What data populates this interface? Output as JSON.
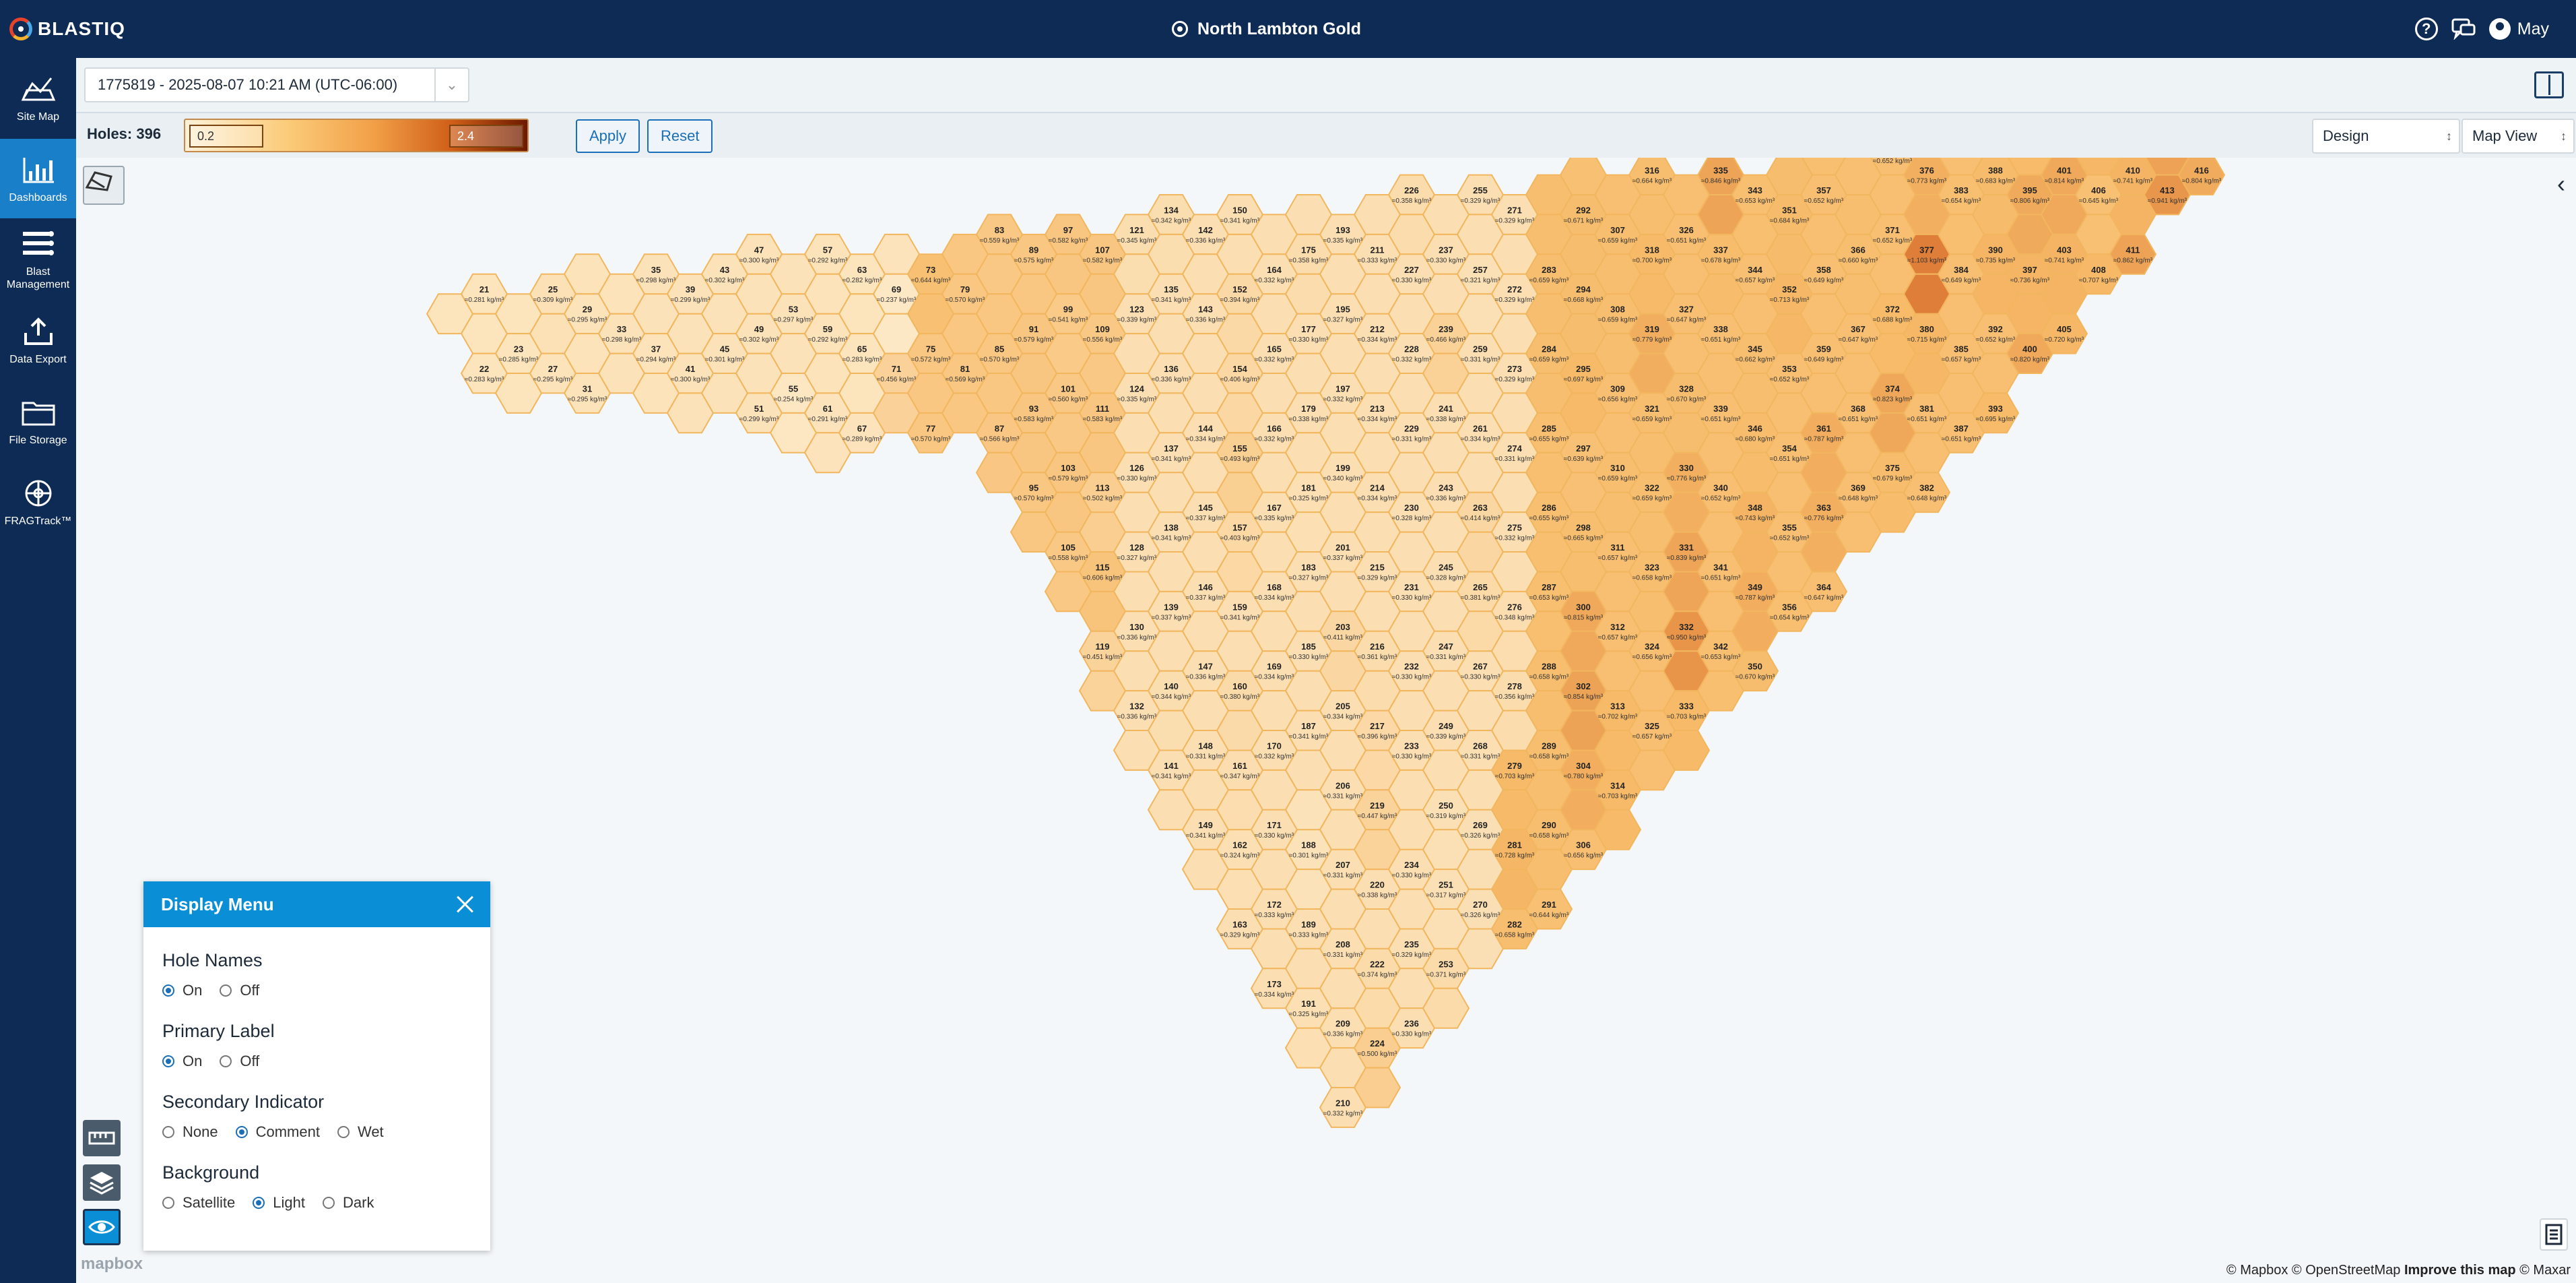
{
  "app": {
    "name": "BLASTIQ",
    "site": "North Lambton Gold",
    "user": "May"
  },
  "icons": {
    "help": "help-icon",
    "chat": "chat-icon",
    "user": "user-icon",
    "site": "location-target-icon"
  },
  "nav": [
    {
      "id": "site-map",
      "label": "Site Map",
      "icon": "site-map-icon",
      "active": false
    },
    {
      "id": "dashboards",
      "label": "Dashboards",
      "icon": "dashboards-icon",
      "active": true
    },
    {
      "id": "blast-management",
      "label": "Blast Management",
      "icon": "blast-management-icon",
      "active": false
    },
    {
      "id": "data-export",
      "label": "Data Export",
      "icon": "data-export-icon",
      "active": false
    },
    {
      "id": "file-storage",
      "label": "File Storage",
      "icon": "file-storage-icon",
      "active": false
    },
    {
      "id": "fragtrack",
      "label": "FRAGTrack™",
      "icon": "fragtrack-icon",
      "active": false
    }
  ],
  "toolbar": {
    "blast_selection": "1775819 - 2025-08-07 10:21 AM (UTC-06:00)",
    "holes_label": "Holes: 396",
    "scale_min": "0.2",
    "scale_max": "2.4",
    "apply_label": "Apply",
    "reset_label": "Reset",
    "design_value": "Design",
    "view_value": "Map View"
  },
  "colors": {
    "nav_bg": "#0d2b55",
    "accent": "#0a8fd6",
    "low": "#fde9c6",
    "mid": "#f6b866",
    "high": "#dc7b30",
    "outline": "#f4b85a"
  },
  "display_menu": {
    "title": "Display Menu",
    "groups": [
      {
        "title": "Hole Names",
        "options": [
          "On",
          "Off"
        ],
        "selected": "On"
      },
      {
        "title": "Primary Label",
        "options": [
          "On",
          "Off"
        ],
        "selected": "On"
      },
      {
        "title": "Secondary Indicator",
        "options": [
          "None",
          "Comment",
          "Wet"
        ],
        "selected": "Comment"
      },
      {
        "title": "Background",
        "options": [
          "Satellite",
          "Light",
          "Dark"
        ],
        "selected": "Light"
      }
    ]
  },
  "map": {
    "unit": "kg/m³",
    "holes": [
      [
        "21",
        "0.281"
      ],
      [
        "22",
        "0.283"
      ],
      [
        "23",
        "0.285"
      ],
      [
        "25",
        "0.309"
      ],
      [
        "27",
        "0.295"
      ],
      [
        "29",
        "0.295"
      ],
      [
        "31",
        "0.295"
      ],
      [
        "33",
        "0.298"
      ],
      [
        "35",
        "0.298"
      ],
      [
        "37",
        "0.294"
      ],
      [
        "39",
        "0.299"
      ],
      [
        "41",
        "0.300"
      ],
      [
        "43",
        "0.302"
      ],
      [
        "45",
        "0.301"
      ],
      [
        "47",
        "0.300"
      ],
      [
        "49",
        "0.302"
      ],
      [
        "51",
        "0.299"
      ],
      [
        "53",
        "0.297"
      ],
      [
        "55",
        "0.254"
      ],
      [
        "57",
        "0.292"
      ],
      [
        "59",
        "0.292"
      ],
      [
        "61",
        "0.291"
      ],
      [
        "63",
        "0.282"
      ],
      [
        "65",
        "0.283"
      ],
      [
        "67",
        "0.289"
      ],
      [
        "69",
        "0.237"
      ],
      [
        "71",
        "0.456"
      ],
      [
        "73",
        "0.644"
      ],
      [
        "75",
        "0.572"
      ],
      [
        "77",
        "0.570"
      ],
      [
        "79",
        "0.570"
      ],
      [
        "81",
        "0.569"
      ],
      [
        "83",
        "0.559"
      ],
      [
        "85",
        "0.570"
      ],
      [
        "87",
        "0.566"
      ],
      [
        "89",
        "0.575"
      ],
      [
        "91",
        "0.579"
      ],
      [
        "93",
        "0.583"
      ],
      [
        "95",
        "0.570"
      ],
      [
        "97",
        "0.582"
      ],
      [
        "99",
        "0.541"
      ],
      [
        "101",
        "0.560"
      ],
      [
        "103",
        "0.579"
      ],
      [
        "105",
        "0.558"
      ],
      [
        "107",
        "0.582"
      ],
      [
        "109",
        "0.556"
      ],
      [
        "111",
        "0.583"
      ],
      [
        "113",
        "0.502"
      ],
      [
        "115",
        "0.606"
      ],
      [
        "119",
        "0.451"
      ],
      [
        "121",
        "0.345"
      ],
      [
        "123",
        "0.339"
      ],
      [
        "124",
        "0.335"
      ],
      [
        "126",
        "0.330"
      ],
      [
        "128",
        "0.327"
      ],
      [
        "130",
        "0.336"
      ],
      [
        "132",
        "0.336"
      ],
      [
        "134",
        "0.342"
      ],
      [
        "135",
        "0.341"
      ],
      [
        "136",
        "0.336"
      ],
      [
        "137",
        "0.341"
      ],
      [
        "138",
        "0.341"
      ],
      [
        "139",
        "0.337"
      ],
      [
        "140",
        "0.344"
      ],
      [
        "141",
        "0.341"
      ],
      [
        "142",
        "0.336"
      ],
      [
        "143",
        "0.336"
      ],
      [
        "144",
        "0.334"
      ],
      [
        "145",
        "0.337"
      ],
      [
        "146",
        "0.337"
      ],
      [
        "147",
        "0.336"
      ],
      [
        "148",
        "0.331"
      ],
      [
        "149",
        "0.341"
      ],
      [
        "150",
        "0.341"
      ],
      [
        "152",
        "0.394"
      ],
      [
        "154",
        "0.406"
      ],
      [
        "155",
        "0.493"
      ],
      [
        "157",
        "0.403"
      ],
      [
        "159",
        "0.341"
      ],
      [
        "160",
        "0.380"
      ],
      [
        "161",
        "0.347"
      ],
      [
        "162",
        "0.324"
      ],
      [
        "163",
        "0.329"
      ],
      [
        "164",
        "0.332"
      ],
      [
        "165",
        "0.332"
      ],
      [
        "166",
        "0.332"
      ],
      [
        "167",
        "0.335"
      ],
      [
        "168",
        "0.334"
      ],
      [
        "169",
        "0.334"
      ],
      [
        "170",
        "0.332"
      ],
      [
        "171",
        "0.330"
      ],
      [
        "172",
        "0.333"
      ],
      [
        "173",
        "0.334"
      ],
      [
        "175",
        "0.358"
      ],
      [
        "177",
        "0.330"
      ],
      [
        "179",
        "0.338"
      ],
      [
        "181",
        "0.325"
      ],
      [
        "183",
        "0.327"
      ],
      [
        "185",
        "0.330"
      ],
      [
        "187",
        "0.341"
      ],
      [
        "188",
        "0.301"
      ],
      [
        "189",
        "0.333"
      ],
      [
        "191",
        "0.325"
      ],
      [
        "193",
        "0.335"
      ],
      [
        "195",
        "0.327"
      ],
      [
        "197",
        "0.332"
      ],
      [
        "199",
        "0.340"
      ],
      [
        "201",
        "0.337"
      ],
      [
        "203",
        "0.411"
      ],
      [
        "205",
        "0.334"
      ],
      [
        "206",
        "0.331"
      ],
      [
        "207",
        "0.331"
      ],
      [
        "208",
        "0.331"
      ],
      [
        "209",
        "0.336"
      ],
      [
        "210",
        "0.332"
      ],
      [
        "211",
        "0.333"
      ],
      [
        "212",
        "0.334"
      ],
      [
        "213",
        "0.334"
      ],
      [
        "214",
        "0.334"
      ],
      [
        "215",
        "0.329"
      ],
      [
        "216",
        "0.361"
      ],
      [
        "217",
        "0.396"
      ],
      [
        "219",
        "0.447"
      ],
      [
        "220",
        "0.338"
      ],
      [
        "222",
        "0.374"
      ],
      [
        "224",
        "0.500"
      ],
      [
        "226",
        "0.358"
      ],
      [
        "227",
        "0.330"
      ],
      [
        "228",
        "0.332"
      ],
      [
        "229",
        "0.331"
      ],
      [
        "230",
        "0.328"
      ],
      [
        "231",
        "0.330"
      ],
      [
        "232",
        "0.330"
      ],
      [
        "233",
        "0.330"
      ],
      [
        "234",
        "0.330"
      ],
      [
        "235",
        "0.329"
      ],
      [
        "236",
        "0.330"
      ],
      [
        "237",
        "0.330"
      ],
      [
        "239",
        "0.466"
      ],
      [
        "241",
        "0.338"
      ],
      [
        "243",
        "0.336"
      ],
      [
        "245",
        "0.328"
      ],
      [
        "247",
        "0.331"
      ],
      [
        "249",
        "0.339"
      ],
      [
        "250",
        "0.319"
      ],
      [
        "251",
        "0.317"
      ],
      [
        "253",
        "0.371"
      ],
      [
        "255",
        "0.329"
      ],
      [
        "257",
        "0.321"
      ],
      [
        "259",
        "0.331"
      ],
      [
        "261",
        "0.334"
      ],
      [
        "263",
        "0.414"
      ],
      [
        "265",
        "0.381"
      ],
      [
        "267",
        "0.330"
      ],
      [
        "268",
        "0.331"
      ],
      [
        "269",
        "0.326"
      ],
      [
        "270",
        "0.326"
      ],
      [
        "271",
        "0.329"
      ],
      [
        "272",
        "0.329"
      ],
      [
        "273",
        "0.329"
      ],
      [
        "274",
        "0.331"
      ],
      [
        "275",
        "0.332"
      ],
      [
        "276",
        "0.348"
      ],
      [
        "278",
        "0.356"
      ],
      [
        "279",
        "0.703"
      ],
      [
        "281",
        "0.728"
      ],
      [
        "282",
        "0.658"
      ],
      [
        "283",
        "0.659"
      ],
      [
        "284",
        "0.659"
      ],
      [
        "285",
        "0.655"
      ],
      [
        "286",
        "0.655"
      ],
      [
        "287",
        "0.653"
      ],
      [
        "288",
        "0.658"
      ],
      [
        "289",
        "0.658"
      ],
      [
        "290",
        "0.658"
      ],
      [
        "291",
        "0.644"
      ],
      [
        "292",
        "0.671"
      ],
      [
        "294",
        "0.668"
      ],
      [
        "295",
        "0.697"
      ],
      [
        "297",
        "0.639"
      ],
      [
        "298",
        "0.665"
      ],
      [
        "300",
        "0.815"
      ],
      [
        "302",
        "0.854"
      ],
      [
        "304",
        "0.780"
      ],
      [
        "306",
        "0.656"
      ],
      [
        "307",
        "0.659"
      ],
      [
        "308",
        "0.659"
      ],
      [
        "309",
        "0.656"
      ],
      [
        "310",
        "0.659"
      ],
      [
        "311",
        "0.657"
      ],
      [
        "312",
        "0.657"
      ],
      [
        "313",
        "0.702"
      ],
      [
        "314",
        "0.703"
      ],
      [
        "316",
        "0.664"
      ],
      [
        "318",
        "0.700"
      ],
      [
        "319",
        "0.779"
      ],
      [
        "321",
        "0.659"
      ],
      [
        "322",
        "0.659"
      ],
      [
        "323",
        "0.658"
      ],
      [
        "324",
        "0.656"
      ],
      [
        "325",
        "0.657"
      ],
      [
        "326",
        "0.651"
      ],
      [
        "327",
        "0.647"
      ],
      [
        "328",
        "0.670"
      ],
      [
        "330",
        "0.776"
      ],
      [
        "331",
        "0.839"
      ],
      [
        "332",
        "0.950"
      ],
      [
        "333",
        "0.703"
      ],
      [
        "335",
        "0.846"
      ],
      [
        "337",
        "0.678"
      ],
      [
        "338",
        "0.651"
      ],
      [
        "339",
        "0.651"
      ],
      [
        "340",
        "0.652"
      ],
      [
        "341",
        "0.651"
      ],
      [
        "342",
        "0.653"
      ],
      [
        "343",
        "0.653"
      ],
      [
        "344",
        "0.657"
      ],
      [
        "345",
        "0.662"
      ],
      [
        "346",
        "0.680"
      ],
      [
        "348",
        "0.743"
      ],
      [
        "349",
        "0.787"
      ],
      [
        "350",
        "0.670"
      ],
      [
        "351",
        "0.684"
      ],
      [
        "352",
        "0.713"
      ],
      [
        "353",
        "0.652"
      ],
      [
        "354",
        "0.651"
      ],
      [
        "355",
        "0.652"
      ],
      [
        "356",
        "0.654"
      ],
      [
        "357",
        "0.652"
      ],
      [
        "358",
        "0.649"
      ],
      [
        "359",
        "0.649"
      ],
      [
        "361",
        "0.787"
      ],
      [
        "363",
        "0.776"
      ],
      [
        "364",
        "0.647"
      ],
      [
        "366",
        "0.660"
      ],
      [
        "367",
        "0.647"
      ],
      [
        "368",
        "0.651"
      ],
      [
        "369",
        "0.648"
      ],
      [
        "370",
        "0.652"
      ],
      [
        "371",
        "0.652"
      ],
      [
        "372",
        "0.688"
      ],
      [
        "374",
        "0.823"
      ],
      [
        "375",
        "0.679"
      ],
      [
        "376",
        "0.773"
      ],
      [
        "377",
        "1.103"
      ],
      [
        "380",
        "0.715"
      ],
      [
        "381",
        "0.651"
      ],
      [
        "382",
        "0.648"
      ],
      [
        "383",
        "0.654"
      ],
      [
        "384",
        "0.649"
      ],
      [
        "385",
        "0.657"
      ],
      [
        "387",
        "0.651"
      ],
      [
        "388",
        "0.683"
      ],
      [
        "390",
        "0.735"
      ],
      [
        "392",
        "0.652"
      ],
      [
        "393",
        "0.695"
      ],
      [
        "395",
        "0.806"
      ],
      [
        "397",
        "0.736"
      ],
      [
        "400",
        "0.820"
      ],
      [
        "401",
        "0.814"
      ],
      [
        "403",
        "0.741"
      ],
      [
        "405",
        "0.720"
      ],
      [
        "406",
        "0.645"
      ],
      [
        "408",
        "0.707"
      ],
      [
        "410",
        "0.741"
      ],
      [
        "411",
        "0.862"
      ],
      [
        "413",
        "0.941"
      ],
      [
        "416",
        "0.804"
      ]
    ]
  },
  "attribution": {
    "text": "© Mapbox © OpenStreetMap",
    "improve": "Improve this map",
    "maxar": "© Maxar",
    "logo": "mapbox"
  }
}
